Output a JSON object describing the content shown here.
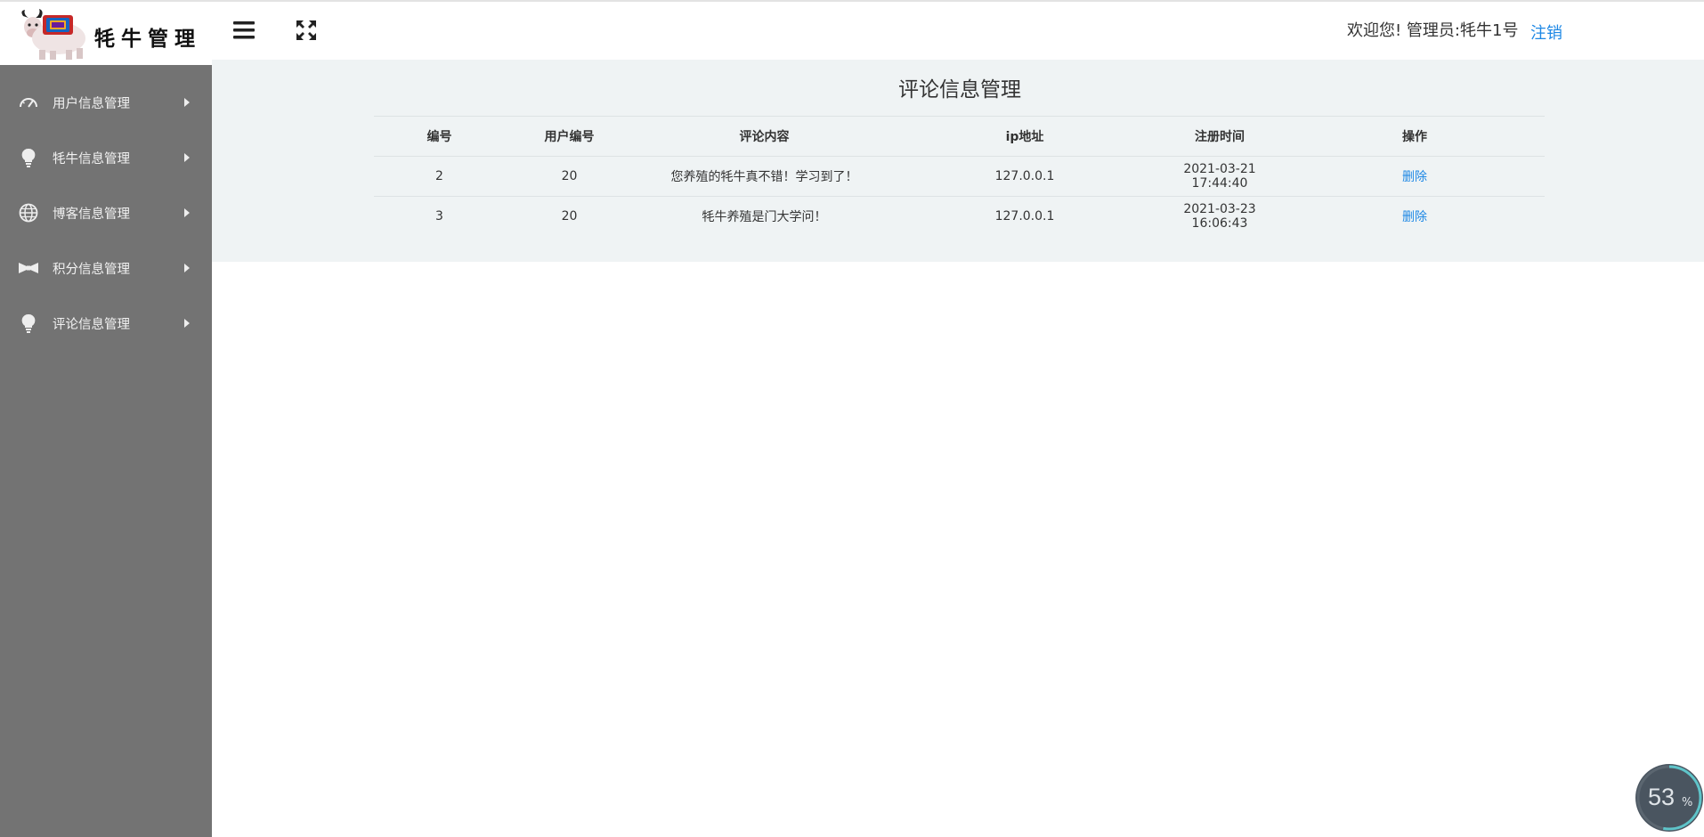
{
  "sidebar": {
    "logo_text": "牦牛管理",
    "items": [
      {
        "label": "用户信息管理",
        "icon": "speedometer-icon"
      },
      {
        "label": "牦牛信息管理",
        "icon": "lightbulb-icon"
      },
      {
        "label": "博客信息管理",
        "icon": "globe-icon"
      },
      {
        "label": "积分信息管理",
        "icon": "bowtie-icon"
      },
      {
        "label": "评论信息管理",
        "icon": "lightbulb-icon"
      }
    ]
  },
  "header": {
    "menu_icon": "hamburger-menu-icon",
    "fullscreen_icon": "fullscreen-icon",
    "welcome": "欢迎您!  管理员:牦牛1号",
    "logout": "注销"
  },
  "main": {
    "title": "评论信息管理",
    "columns": [
      "编号",
      "用户编号",
      "评论内容",
      "ip地址",
      "注册时间",
      "操作"
    ],
    "rows": [
      {
        "id": "2",
        "user_id": "20",
        "content": "您养殖的牦牛真不错！学习到了！",
        "ip": "127.0.0.1",
        "time": "2021-03-21 17:44:40",
        "action": "删除"
      },
      {
        "id": "3",
        "user_id": "20",
        "content": "牦牛养殖是门大学问！",
        "ip": "127.0.0.1",
        "time": "2021-03-23 16:06:43",
        "action": "删除"
      }
    ]
  },
  "progress": {
    "value": "53",
    "unit": "%",
    "fraction": 0.53
  },
  "colors": {
    "sidebar_bg": "#737373",
    "panel_bg": "#eff3f4",
    "link": "#1e88e5",
    "widget_bg": "#4a5560",
    "widget_ring": "#5ec4c9"
  }
}
